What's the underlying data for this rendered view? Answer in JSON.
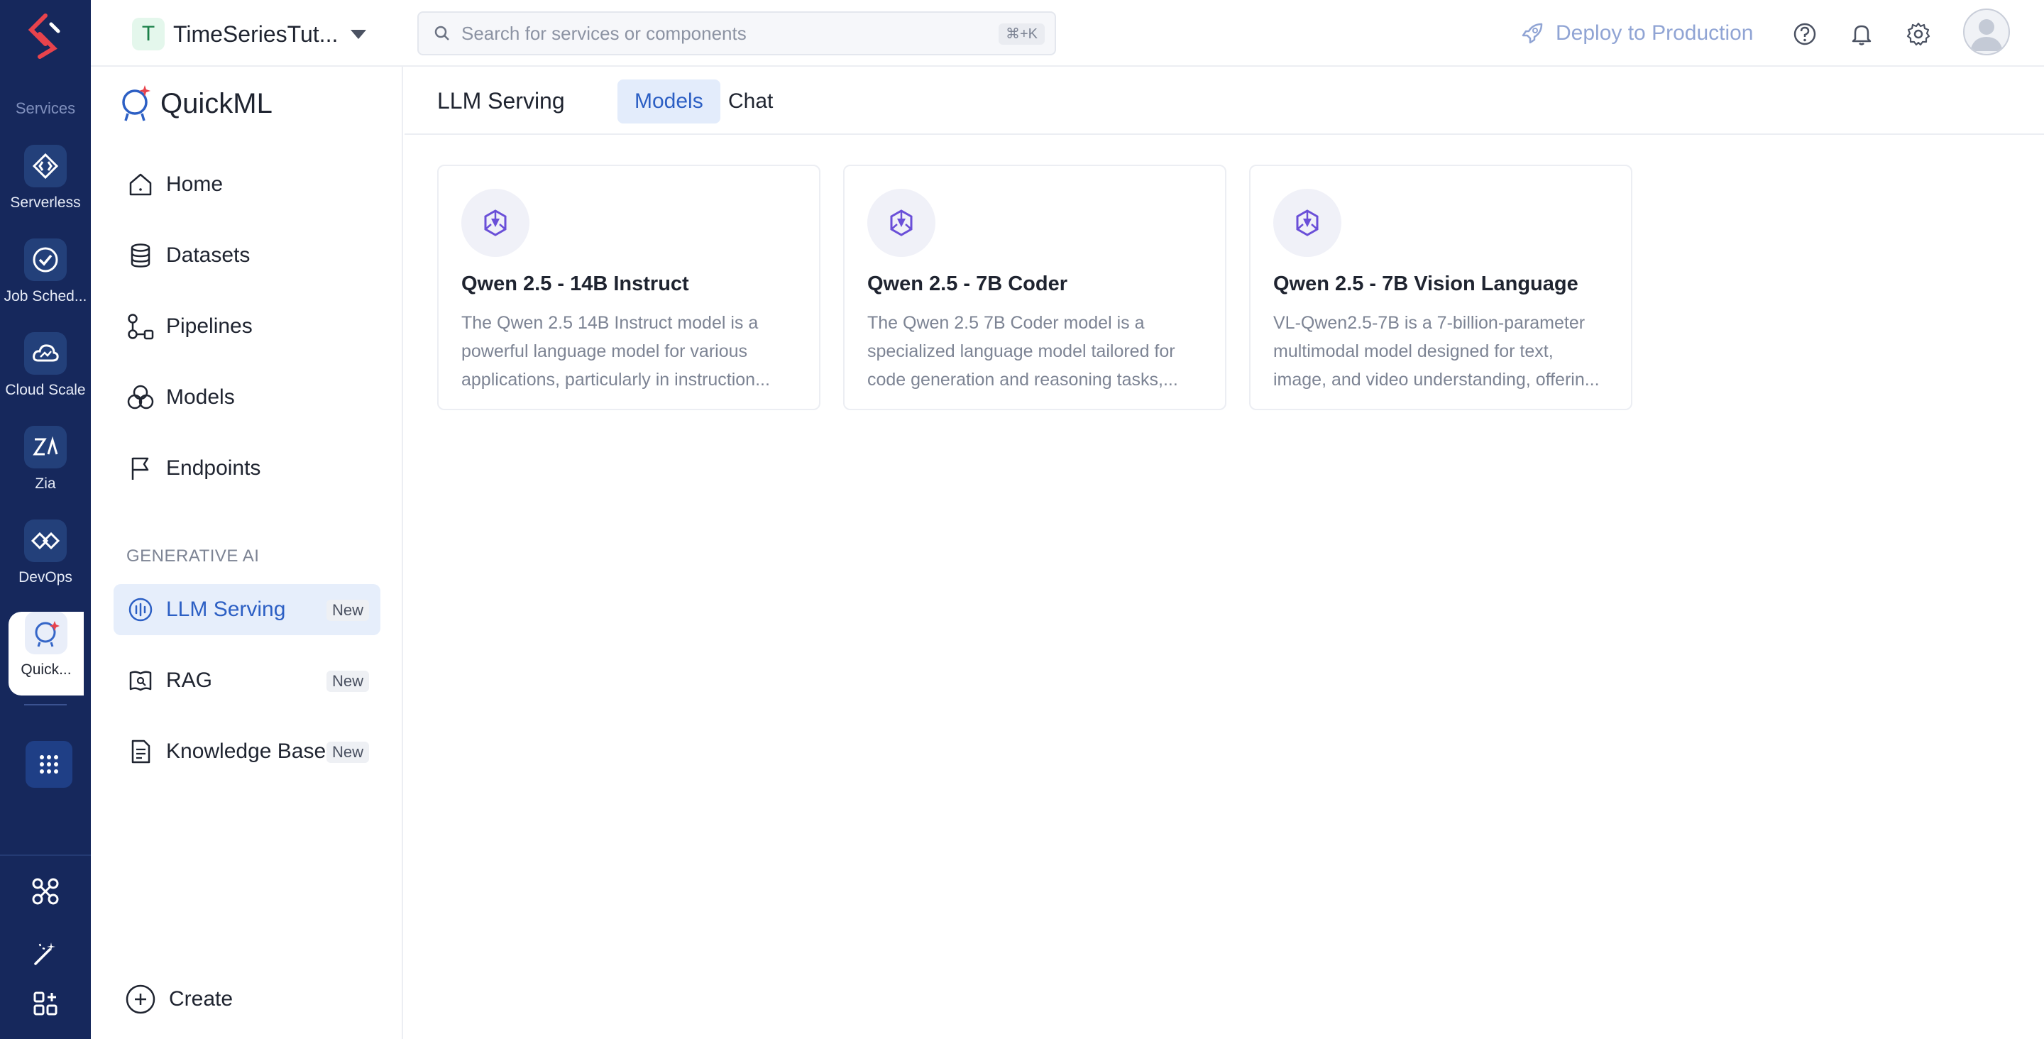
{
  "rail": {
    "heading": "Services",
    "items": [
      {
        "label": "Serverless",
        "icon": "serverless-icon"
      },
      {
        "label": "Job Sched...",
        "icon": "job-scheduling-icon"
      },
      {
        "label": "Cloud Scale",
        "icon": "cloud-scale-icon"
      },
      {
        "label": "Zia",
        "icon": "zia-icon"
      },
      {
        "label": "DevOps",
        "icon": "devops-icon"
      },
      {
        "label": "Quick...",
        "icon": "quickml-icon",
        "active": true
      }
    ]
  },
  "topbar": {
    "project_initial": "T",
    "project_name": "TimeSeriesTut...",
    "search_placeholder": "Search for services or components",
    "search_shortcut": "⌘+K",
    "deploy_label": "Deploy to Production"
  },
  "sidebar": {
    "brand": "QuickML",
    "items": [
      {
        "label": "Home",
        "icon": "home-icon"
      },
      {
        "label": "Datasets",
        "icon": "database-icon"
      },
      {
        "label": "Pipelines",
        "icon": "pipeline-icon"
      },
      {
        "label": "Models",
        "icon": "models-icon"
      },
      {
        "label": "Endpoints",
        "icon": "flag-icon"
      }
    ],
    "section_label": "GENERATIVE AI",
    "genai_items": [
      {
        "label": "LLM Serving",
        "badge": "New",
        "active": true
      },
      {
        "label": "RAG",
        "badge": "New"
      },
      {
        "label": "Knowledge Base",
        "badge": "New"
      }
    ],
    "create_label": "Create"
  },
  "main": {
    "title": "LLM Serving",
    "tabs": [
      {
        "label": "Models",
        "active": true
      },
      {
        "label": "Chat"
      }
    ],
    "cards": [
      {
        "title": "Qwen 2.5 - 14B Instruct",
        "description": "The Qwen 2.5 14B Instruct model is a powerful language model for various applications, particularly in instruction..."
      },
      {
        "title": "Qwen 2.5 - 7B Coder",
        "description": "The Qwen 2.5 7B Coder model is a specialized language model tailored for code generation and reasoning tasks,..."
      },
      {
        "title": "Qwen 2.5 - 7B Vision Language",
        "description": "VL-Qwen2.5-7B is a 7-billion-parameter multimodal model designed for text, image, and video understanding, offerin..."
      }
    ]
  },
  "colors": {
    "rail_bg": "#16285c",
    "accent": "#2c5fc4",
    "active_bg": "#e6eefb"
  }
}
